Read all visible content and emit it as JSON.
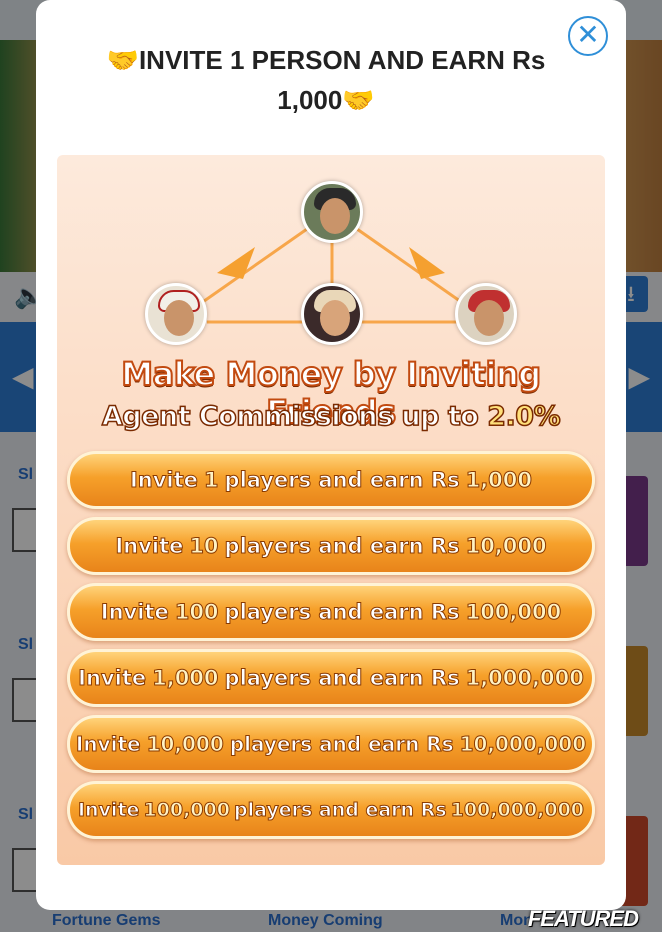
{
  "modal": {
    "title_line1": "🤝INVITE 1 PERSON AND EARN Rs",
    "title_line2": "1,000🤝",
    "close_glyph": "✕"
  },
  "promo": {
    "headline": "Make Money by Inviting Friends",
    "subhead_prefix": "Agent Commissions up to ",
    "subhead_pct": "2.0%",
    "tiers": [
      {
        "prefix": "Invite",
        "count": "1",
        "middle": "players and earn Rs",
        "amount": "1,000"
      },
      {
        "prefix": "Invite",
        "count": "10",
        "middle": "players and earn Rs",
        "amount": "10,000"
      },
      {
        "prefix": "Invite",
        "count": "100",
        "middle": "players and earn Rs",
        "amount": "100,000"
      },
      {
        "prefix": "Invite",
        "count": "1,000",
        "middle": "players and earn Rs",
        "amount": "1,000,000"
      },
      {
        "prefix": "Invite",
        "count": "10,000",
        "middle": "players and earn Rs",
        "amount": "10,000,000"
      },
      {
        "prefix": "Invite",
        "count": "100,000",
        "middle": "players and earn Rs",
        "amount": "100,000,000"
      }
    ]
  },
  "background": {
    "section_label": "Sl",
    "bottom_labels": [
      "Fortune Gems",
      "Money Coming",
      "Mon"
    ],
    "featured": "FEATURED"
  },
  "colors": {
    "accent_blue": "#2f8fd8",
    "pill_orange": "#f6a02a"
  }
}
